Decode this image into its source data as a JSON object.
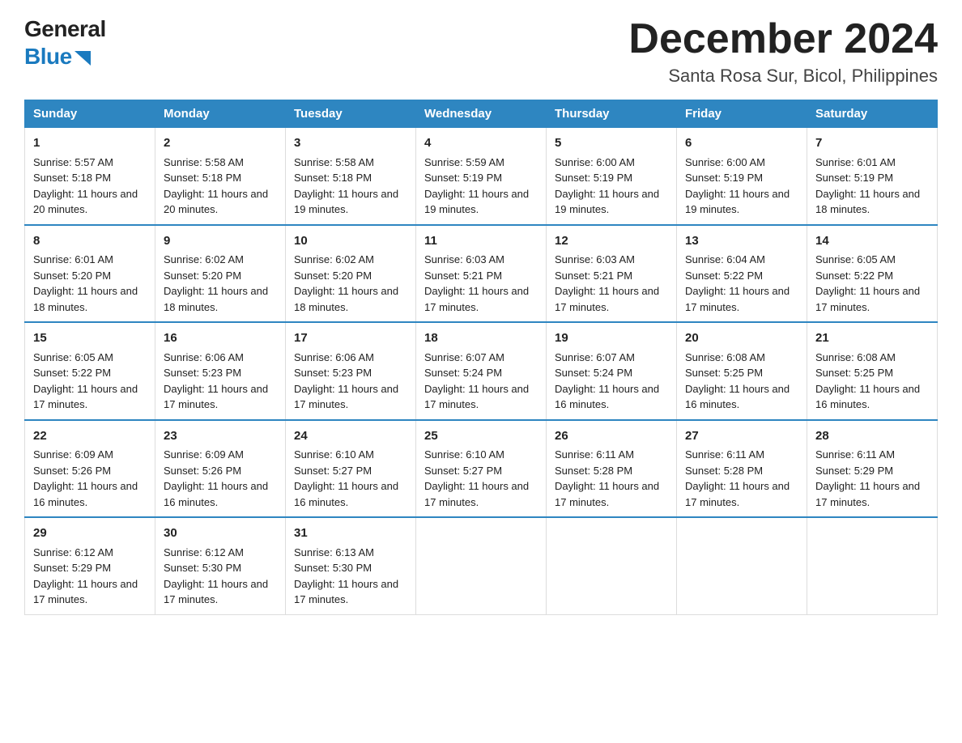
{
  "logo": {
    "general": "General",
    "blue": "Blue"
  },
  "title": {
    "month": "December 2024",
    "location": "Santa Rosa Sur, Bicol, Philippines"
  },
  "weekdays": [
    "Sunday",
    "Monday",
    "Tuesday",
    "Wednesday",
    "Thursday",
    "Friday",
    "Saturday"
  ],
  "weeks": [
    [
      {
        "day": "1",
        "sunrise": "5:57 AM",
        "sunset": "5:18 PM",
        "daylight": "11 hours and 20 minutes."
      },
      {
        "day": "2",
        "sunrise": "5:58 AM",
        "sunset": "5:18 PM",
        "daylight": "11 hours and 20 minutes."
      },
      {
        "day": "3",
        "sunrise": "5:58 AM",
        "sunset": "5:18 PM",
        "daylight": "11 hours and 19 minutes."
      },
      {
        "day": "4",
        "sunrise": "5:59 AM",
        "sunset": "5:19 PM",
        "daylight": "11 hours and 19 minutes."
      },
      {
        "day": "5",
        "sunrise": "6:00 AM",
        "sunset": "5:19 PM",
        "daylight": "11 hours and 19 minutes."
      },
      {
        "day": "6",
        "sunrise": "6:00 AM",
        "sunset": "5:19 PM",
        "daylight": "11 hours and 19 minutes."
      },
      {
        "day": "7",
        "sunrise": "6:01 AM",
        "sunset": "5:19 PM",
        "daylight": "11 hours and 18 minutes."
      }
    ],
    [
      {
        "day": "8",
        "sunrise": "6:01 AM",
        "sunset": "5:20 PM",
        "daylight": "11 hours and 18 minutes."
      },
      {
        "day": "9",
        "sunrise": "6:02 AM",
        "sunset": "5:20 PM",
        "daylight": "11 hours and 18 minutes."
      },
      {
        "day": "10",
        "sunrise": "6:02 AM",
        "sunset": "5:20 PM",
        "daylight": "11 hours and 18 minutes."
      },
      {
        "day": "11",
        "sunrise": "6:03 AM",
        "sunset": "5:21 PM",
        "daylight": "11 hours and 17 minutes."
      },
      {
        "day": "12",
        "sunrise": "6:03 AM",
        "sunset": "5:21 PM",
        "daylight": "11 hours and 17 minutes."
      },
      {
        "day": "13",
        "sunrise": "6:04 AM",
        "sunset": "5:22 PM",
        "daylight": "11 hours and 17 minutes."
      },
      {
        "day": "14",
        "sunrise": "6:05 AM",
        "sunset": "5:22 PM",
        "daylight": "11 hours and 17 minutes."
      }
    ],
    [
      {
        "day": "15",
        "sunrise": "6:05 AM",
        "sunset": "5:22 PM",
        "daylight": "11 hours and 17 minutes."
      },
      {
        "day": "16",
        "sunrise": "6:06 AM",
        "sunset": "5:23 PM",
        "daylight": "11 hours and 17 minutes."
      },
      {
        "day": "17",
        "sunrise": "6:06 AM",
        "sunset": "5:23 PM",
        "daylight": "11 hours and 17 minutes."
      },
      {
        "day": "18",
        "sunrise": "6:07 AM",
        "sunset": "5:24 PM",
        "daylight": "11 hours and 17 minutes."
      },
      {
        "day": "19",
        "sunrise": "6:07 AM",
        "sunset": "5:24 PM",
        "daylight": "11 hours and 16 minutes."
      },
      {
        "day": "20",
        "sunrise": "6:08 AM",
        "sunset": "5:25 PM",
        "daylight": "11 hours and 16 minutes."
      },
      {
        "day": "21",
        "sunrise": "6:08 AM",
        "sunset": "5:25 PM",
        "daylight": "11 hours and 16 minutes."
      }
    ],
    [
      {
        "day": "22",
        "sunrise": "6:09 AM",
        "sunset": "5:26 PM",
        "daylight": "11 hours and 16 minutes."
      },
      {
        "day": "23",
        "sunrise": "6:09 AM",
        "sunset": "5:26 PM",
        "daylight": "11 hours and 16 minutes."
      },
      {
        "day": "24",
        "sunrise": "6:10 AM",
        "sunset": "5:27 PM",
        "daylight": "11 hours and 16 minutes."
      },
      {
        "day": "25",
        "sunrise": "6:10 AM",
        "sunset": "5:27 PM",
        "daylight": "11 hours and 17 minutes."
      },
      {
        "day": "26",
        "sunrise": "6:11 AM",
        "sunset": "5:28 PM",
        "daylight": "11 hours and 17 minutes."
      },
      {
        "day": "27",
        "sunrise": "6:11 AM",
        "sunset": "5:28 PM",
        "daylight": "11 hours and 17 minutes."
      },
      {
        "day": "28",
        "sunrise": "6:11 AM",
        "sunset": "5:29 PM",
        "daylight": "11 hours and 17 minutes."
      }
    ],
    [
      {
        "day": "29",
        "sunrise": "6:12 AM",
        "sunset": "5:29 PM",
        "daylight": "11 hours and 17 minutes."
      },
      {
        "day": "30",
        "sunrise": "6:12 AM",
        "sunset": "5:30 PM",
        "daylight": "11 hours and 17 minutes."
      },
      {
        "day": "31",
        "sunrise": "6:13 AM",
        "sunset": "5:30 PM",
        "daylight": "11 hours and 17 minutes."
      },
      null,
      null,
      null,
      null
    ]
  ]
}
